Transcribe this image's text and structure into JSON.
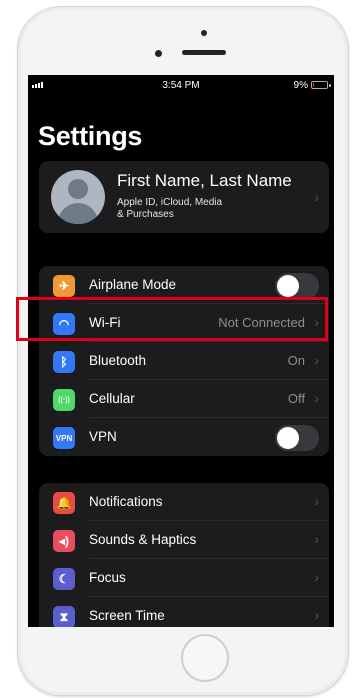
{
  "status_bar": {
    "time": "3:54 PM",
    "battery": "9%",
    "battery_level": 0.09
  },
  "title": "Settings",
  "profile": {
    "name": "First Name, Last Name",
    "subtitle_line1": "Apple ID, iCloud, Media",
    "subtitle_line2": "& Purchases"
  },
  "connectivity": [
    {
      "label": "Airplane Mode",
      "icon": "airplane-icon",
      "color": "#f09a37",
      "toggle": false
    },
    {
      "label": "Wi-Fi",
      "value": "Not Connected",
      "icon": "wifi-icon",
      "color": "#3478f6",
      "highlighted": true
    },
    {
      "label": "Bluetooth",
      "value": "On",
      "icon": "bluetooth-icon",
      "color": "#3478f6"
    },
    {
      "label": "Cellular",
      "value": "Off",
      "icon": "cellular-antenna-icon",
      "color": "#4cd964"
    },
    {
      "label": "VPN",
      "icon_text": "VPN",
      "icon": "vpn-icon",
      "color": "#3478f6",
      "toggle": false
    }
  ],
  "general": [
    {
      "label": "Notifications",
      "icon": "bell-icon",
      "color": "#ea4d3d"
    },
    {
      "label": "Sounds & Haptics",
      "icon": "speaker-icon",
      "color": "#ea4d5e"
    },
    {
      "label": "Focus",
      "icon": "moon-icon",
      "color": "#5b5fcd"
    },
    {
      "label": "Screen Time",
      "icon": "hourglass-icon",
      "color": "#5b5fcd"
    }
  ],
  "highlight_color": "#e0001b"
}
